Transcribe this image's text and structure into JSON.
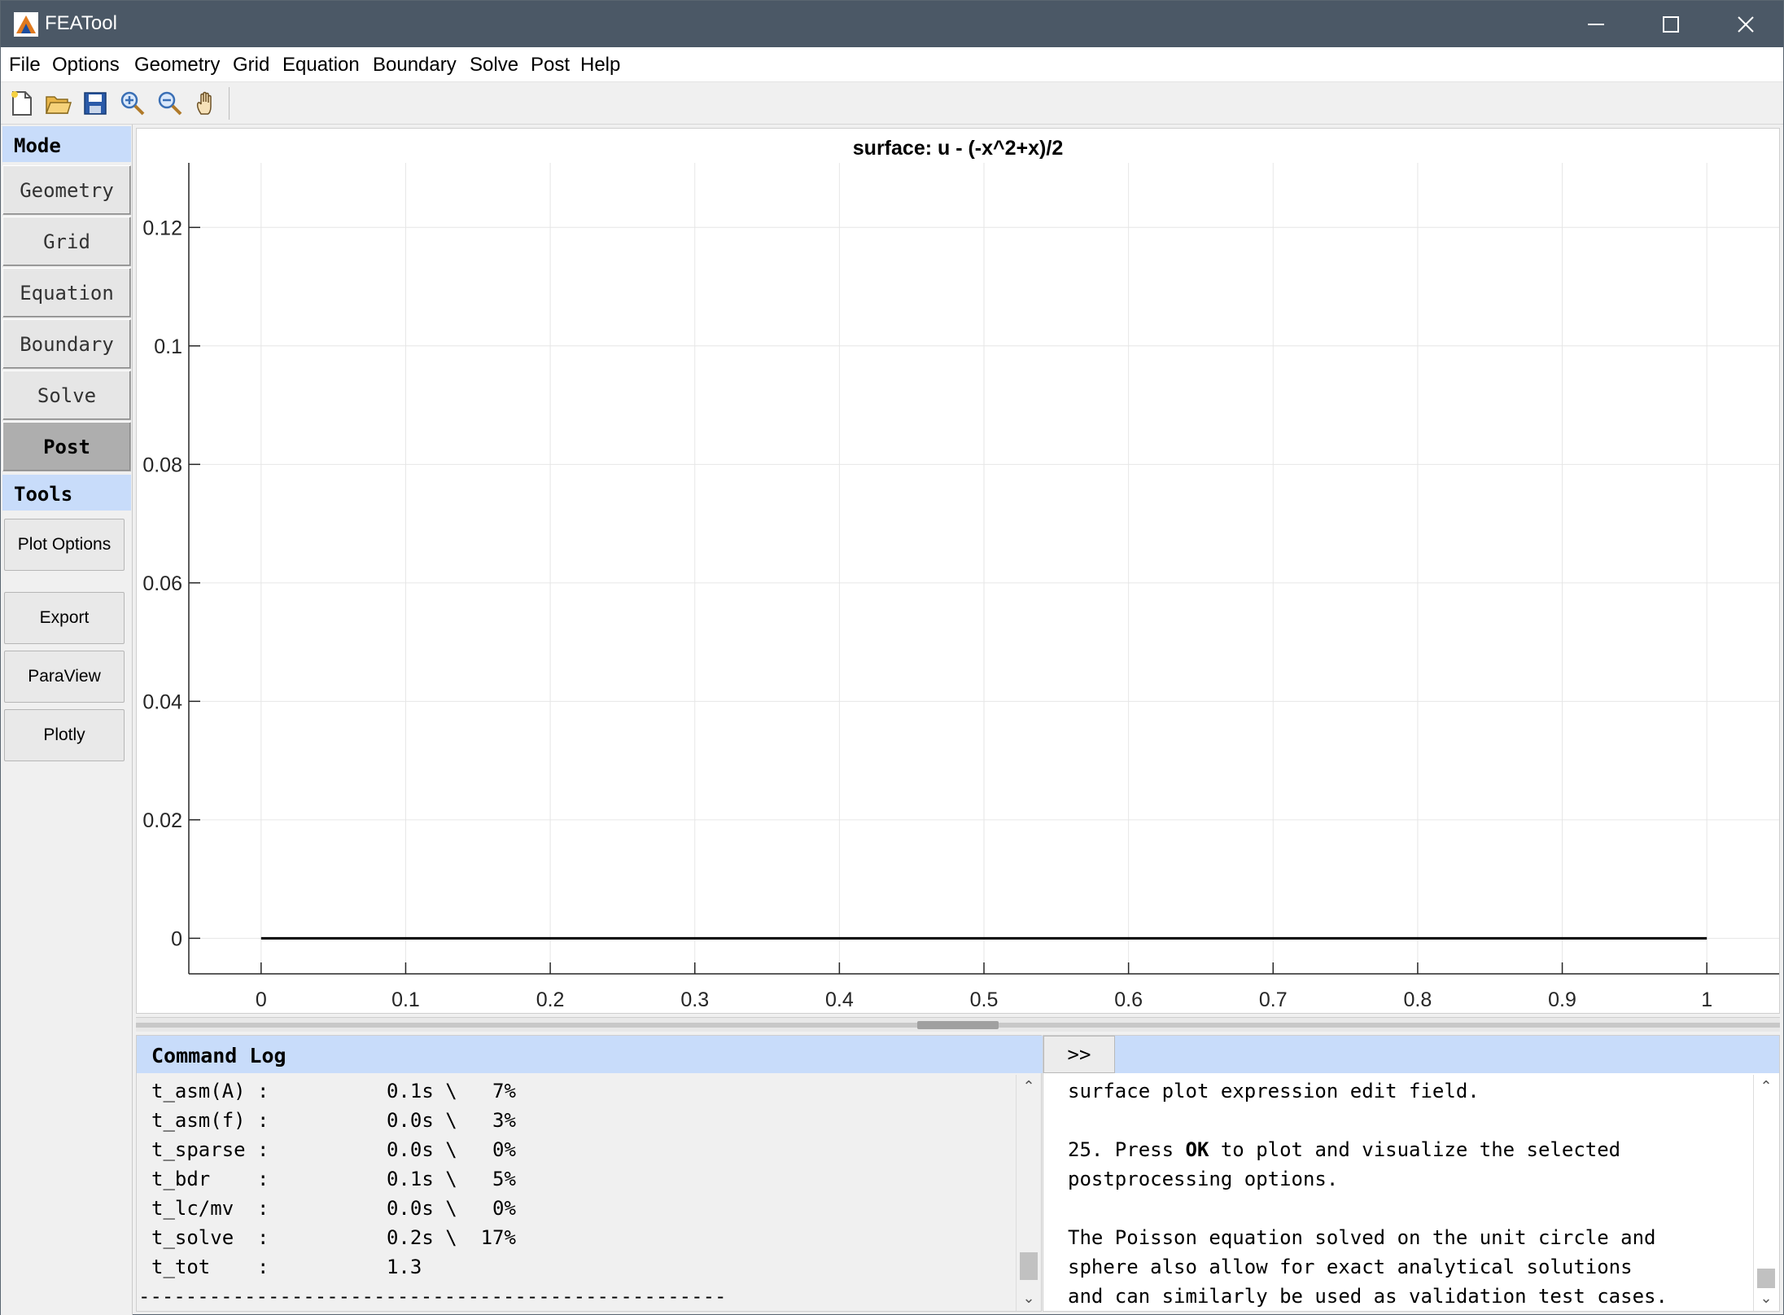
{
  "window": {
    "title": "FEATool"
  },
  "menu": [
    "File",
    "Options",
    "Geometry",
    "Grid",
    "Equation",
    "Boundary",
    "Solve",
    "Post",
    "Help"
  ],
  "toolbar": [
    "new-file-icon",
    "open-folder-icon",
    "save-icon",
    "zoom-in-icon",
    "zoom-out-icon",
    "pan-hand-icon"
  ],
  "sidebar": {
    "mode_header": "Mode",
    "modes": [
      "Geometry",
      "Grid",
      "Equation",
      "Boundary",
      "Solve",
      "Post"
    ],
    "active_mode": "Post",
    "tools_header": "Tools",
    "tools": [
      "Plot Options",
      "Export",
      "ParaView",
      "Plotly"
    ]
  },
  "chart_data": {
    "type": "line",
    "title": "surface: u - (-x^2+x)/2",
    "xlabel": "",
    "ylabel": "",
    "xlim": [
      -0.05,
      1.05
    ],
    "ylim": [
      -0.006,
      0.1309
    ],
    "xticks": [
      "0",
      "0.1",
      "0.2",
      "0.3",
      "0.4",
      "0.5",
      "0.6",
      "0.7",
      "0.8",
      "0.9",
      "1"
    ],
    "yticks": [
      "0",
      "0.02",
      "0.04",
      "0.06",
      "0.08",
      "0.1",
      "0.12"
    ],
    "grid": true,
    "series": [
      {
        "x": [
          0,
          0.1,
          0.2,
          0.3,
          0.4,
          0.5,
          0.6,
          0.7,
          0.8,
          0.9,
          1
        ],
        "values": [
          0,
          0,
          0,
          0,
          0,
          0,
          0,
          0,
          0,
          0,
          0
        ],
        "color": "#000000"
      }
    ]
  },
  "command_log": {
    "header": "Command Log",
    "lines": [
      "t_asm(A) :          0.1s \\   7%",
      "t_asm(f) :          0.0s \\   3%",
      "t_sparse :          0.0s \\   0%",
      "t_bdr    :          0.1s \\   5%",
      "t_lc/mv  :          0.0s \\   0%",
      "t_solve  :          0.2s \\  17%",
      "t_tot    :          1.3",
      "--------------------------------------------------"
    ]
  },
  "help": {
    "expand_label": ">>",
    "line1": "surface plot expression edit field.",
    "step_pre": "25. Press ",
    "step_bold": "OK",
    "step_post": " to plot and visualize the selected",
    "line3": "postprocessing options.",
    "line4": "The Poisson equation solved on the unit circle and",
    "line5": "sphere also allow for exact analytical solutions",
    "line6": "and can similarly be used as validation test cases."
  },
  "colors": {
    "titlebar": "#4b5866",
    "header_blue": "#c8dcfa",
    "active_mode": "#aeaeae"
  }
}
